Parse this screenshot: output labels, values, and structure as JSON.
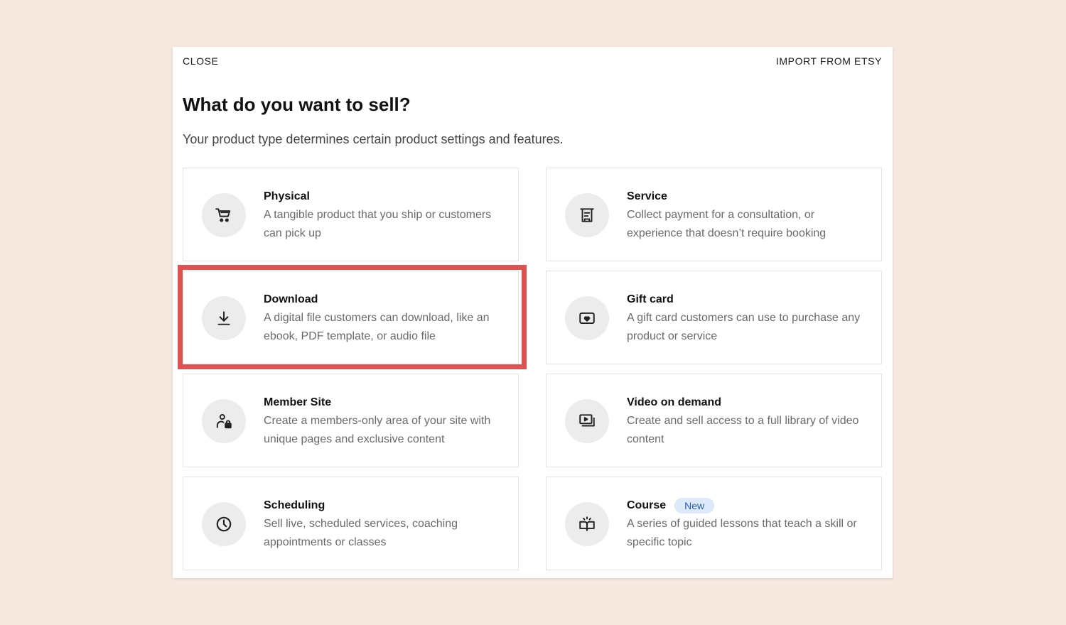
{
  "topbar": {
    "close_label": "CLOSE",
    "import_label": "IMPORT FROM ETSY"
  },
  "heading": {
    "title": "What do you want to sell?",
    "subtitle": "Your product type determines certain product settings and features."
  },
  "options": [
    {
      "name": "Physical",
      "desc": "A tangible product that you ship or customers can pick up",
      "icon": "cart-icon"
    },
    {
      "name": "Service",
      "desc": "Collect payment for a consultation, or experience that doesn’t require booking",
      "icon": "receipt-icon"
    },
    {
      "name": "Download",
      "desc": "A digital file customers can download, like an ebook, PDF template, or audio file",
      "icon": "download-icon",
      "highlighted": true
    },
    {
      "name": "Gift card",
      "desc": "A gift card customers can use to purchase any product or service",
      "icon": "gift-card-icon"
    },
    {
      "name": "Member Site",
      "desc": "Create a members-only area of your site with unique pages and exclusive content",
      "icon": "member-lock-icon"
    },
    {
      "name": "Video on demand",
      "desc": "Create and sell access to a full library of video content",
      "icon": "video-library-icon"
    },
    {
      "name": "Scheduling",
      "desc": "Sell live, scheduled services, coaching appointments or classes",
      "icon": "clock-icon"
    },
    {
      "name": "Course",
      "desc": "A series of guided lessons that teach a skill or specific topic",
      "icon": "book-icon",
      "badge": "New"
    }
  ],
  "colors": {
    "background": "#f5e8df",
    "highlight": "#e05252",
    "badge_bg": "#dbe9fb",
    "badge_text": "#2d5ea8"
  }
}
